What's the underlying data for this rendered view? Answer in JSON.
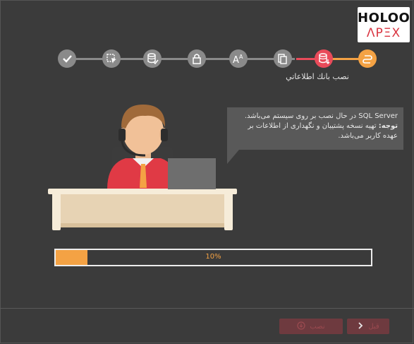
{
  "brand": {
    "line1": "HOLOO",
    "line2": "ΛPΞX"
  },
  "steps": [
    {
      "icon": "check-icon",
      "state": "done"
    },
    {
      "icon": "select-pointer-icon",
      "state": "pending"
    },
    {
      "icon": "database-check-icon",
      "state": "pending"
    },
    {
      "icon": "lock-icon",
      "state": "pending"
    },
    {
      "icon": "font-size-icon",
      "state": "pending"
    },
    {
      "icon": "document-copy-icon",
      "state": "pending"
    },
    {
      "icon": "database-install-icon",
      "state": "active"
    },
    {
      "icon": "link-icon",
      "state": "next"
    }
  ],
  "current_step_label": "نصب بانك اطلاعاتي",
  "message": {
    "line1": "SQL Server  در حال نصب بر روی سیستم می‌باشد.",
    "note_label": "توجه:",
    "note_text": " تهیه نسخه پشتیبان و نگهداری از اطلاعات بر عهده کاربر می‌باشد."
  },
  "progress": {
    "value": 10,
    "label": "10%"
  },
  "buttons": {
    "install": "نصب",
    "previous": "قبل"
  },
  "colors": {
    "accent": "#f4a244",
    "active_step": "#e94b5a",
    "disabled_button": "#6e3a3f"
  }
}
